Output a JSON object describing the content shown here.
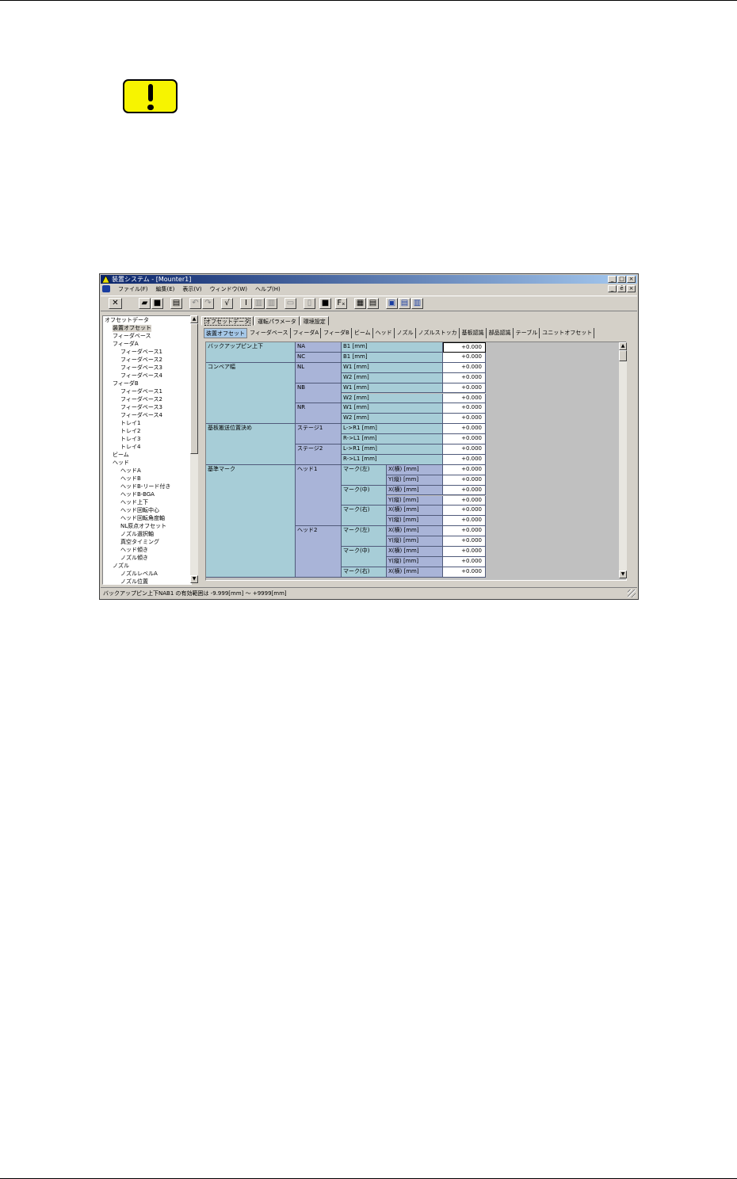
{
  "window": {
    "title": "装置システム - [Mounter1]",
    "min": "_",
    "max": "□",
    "close": "×",
    "restore": "ē"
  },
  "menu": [
    "ファイル(F)",
    "編集(E)",
    "表示(V)",
    "ウィンドウ(W)",
    "ヘルプ(H)"
  ],
  "toolbar": {
    "close": "✕",
    "check": "√",
    "insert": "I",
    "fx": "Fₓ"
  },
  "tree": [
    {
      "label": "オフセットデータ",
      "indent": 0
    },
    {
      "label": "装置オフセット",
      "indent": 2,
      "selected": true
    },
    {
      "label": "フィーダベース",
      "indent": 2
    },
    {
      "label": "フィーダA",
      "indent": 2
    },
    {
      "label": "フィーダベース1",
      "indent": 4
    },
    {
      "label": "フィーダベース2",
      "indent": 4
    },
    {
      "label": "フィーダベース3",
      "indent": 4
    },
    {
      "label": "フィーダベース4",
      "indent": 4
    },
    {
      "label": "フィーダB",
      "indent": 2
    },
    {
      "label": "フィーダベース1",
      "indent": 4
    },
    {
      "label": "フィーダベース2",
      "indent": 4
    },
    {
      "label": "フィーダベース3",
      "indent": 4
    },
    {
      "label": "フィーダベース4",
      "indent": 4
    },
    {
      "label": "トレイ1",
      "indent": 4
    },
    {
      "label": "トレイ2",
      "indent": 4
    },
    {
      "label": "トレイ3",
      "indent": 4
    },
    {
      "label": "トレイ4",
      "indent": 4
    },
    {
      "label": "ビーム",
      "indent": 2
    },
    {
      "label": "ヘッド",
      "indent": 2
    },
    {
      "label": "ヘッドA",
      "indent": 4
    },
    {
      "label": "ヘッドB",
      "indent": 4
    },
    {
      "label": "ヘッドB-リード付き",
      "indent": 4
    },
    {
      "label": "ヘッドB-BGA",
      "indent": 4
    },
    {
      "label": "ヘッド上下",
      "indent": 4
    },
    {
      "label": "ヘッド回転中心",
      "indent": 4
    },
    {
      "label": "ヘッド回転角度軸",
      "indent": 4
    },
    {
      "label": "NL原点オフセット",
      "indent": 4
    },
    {
      "label": "ノズル選択軸",
      "indent": 4
    },
    {
      "label": "真空タイミング",
      "indent": 4
    },
    {
      "label": "ヘッド傾き",
      "indent": 4
    },
    {
      "label": "ノズル傾き",
      "indent": 4
    },
    {
      "label": "ノズル",
      "indent": 2
    },
    {
      "label": "ノズルレベルA",
      "indent": 4
    },
    {
      "label": "ノズル位置",
      "indent": 4
    }
  ],
  "tabs_top": [
    "オフセットデータ",
    "運転パラメータ",
    "環境設定"
  ],
  "tabs_sub": [
    "装置オフセット",
    "フィーダベース",
    "フィーダA",
    "フィーダB",
    "ビーム",
    "ヘッド",
    "ノズル",
    "ノズルストッカ",
    "基板認識",
    "部品認識",
    "テーブル",
    "ユニットオフセット"
  ],
  "grid": {
    "groups": [
      {
        "label": "バックアップピン上下",
        "rows": 2
      },
      {
        "label": "コンベア幅",
        "rows": 6
      },
      {
        "label": "基板搬送位置決め",
        "rows": 4
      },
      {
        "label": "基準マーク",
        "rows": 11
      }
    ],
    "sub": [
      {
        "label": "NA",
        "row": 0,
        "rows": 1
      },
      {
        "label": "NC",
        "row": 1,
        "rows": 1
      },
      {
        "label": "NL",
        "row": 2,
        "rows": 2
      },
      {
        "label": "NB",
        "row": 4,
        "rows": 2
      },
      {
        "label": "NR",
        "row": 6,
        "rows": 2
      },
      {
        "label": "ステージ1",
        "row": 8,
        "rows": 2
      },
      {
        "label": "ステージ2",
        "row": 10,
        "rows": 2
      },
      {
        "label": "ヘッド1",
        "row": 12,
        "rows": 6
      },
      {
        "label": "ヘッド2",
        "row": 18,
        "rows": 5
      }
    ],
    "marks": [
      {
        "label": "マーク(左)",
        "row": 12
      },
      {
        "label": "マーク(中)",
        "row": 14
      },
      {
        "label": "マーク(右)",
        "row": 16
      },
      {
        "label": "マーク(左)",
        "row": 18
      },
      {
        "label": "マーク(中)",
        "row": 20
      },
      {
        "label": "マーク(右)",
        "row": 22
      }
    ],
    "params": [
      "B1 [mm]",
      "B1 [mm]",
      "W1 [mm]",
      "W2 [mm]",
      "W1 [mm]",
      "W2 [mm]",
      "W1 [mm]",
      "W2 [mm]",
      "L->R1 [mm]",
      "R->L1 [mm]",
      "L->R1 [mm]",
      "R->L1 [mm]",
      "X(横) [mm]",
      "Y(縦) [mm]",
      "X(横) [mm]",
      "Y(縦) [mm]",
      "X(横) [mm]",
      "Y(縦) [mm]",
      "X(横) [mm]",
      "Y(縦) [mm]",
      "X(横) [mm]",
      "Y(縦) [mm]",
      "X(横) [mm]"
    ],
    "values": [
      "+0.000",
      "+0.000",
      "+0.000",
      "+0.000",
      "+0.000",
      "+0.000",
      "+0.000",
      "+0.000",
      "+0.000",
      "+0.000",
      "+0.000",
      "+0.000",
      "+0.000",
      "+0.000",
      "+0.000",
      "+0.000",
      "+0.000",
      "+0.000",
      "+0.000",
      "+0.000",
      "+0.000",
      "+0.000",
      "+0.000"
    ]
  },
  "status": "バックアップピン上下NAB1 の有効範囲は -9.999[mm] ～ +9999[mm]",
  "colors": {
    "accent": "#0a246a",
    "warning": "#f7f400",
    "grid_teal": "#a7cdd7",
    "grid_blue": "#a9b4d8"
  }
}
